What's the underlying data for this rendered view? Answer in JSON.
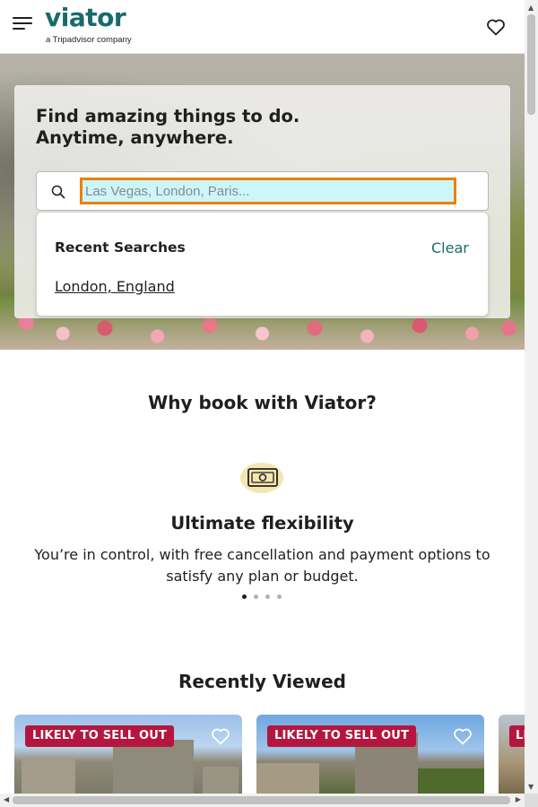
{
  "header": {
    "logo_text": "viator",
    "logo_subtext": "a Tripadvisor company",
    "menu_icon": "hamburger-menu-icon",
    "wishlist_icon": "heart-outline-icon"
  },
  "hero": {
    "title_line1": "Find amazing things to do.",
    "title_line2": "Anytime, anywhere.",
    "search": {
      "placeholder": "Las Vegas, London, Paris...",
      "value": "",
      "icon": "search-icon"
    },
    "recent": {
      "label": "Recent Searches",
      "clear_label": "Clear",
      "items": [
        "London, England"
      ]
    }
  },
  "why_book": {
    "title": "Why book with Viator?",
    "feature": {
      "icon": "money-bill-icon",
      "title": "Ultimate flexibility",
      "description": "You’re in control, with free cancellation and payment options to satisfy any plan or budget."
    },
    "carousel_dots": 4,
    "active_dot": 0
  },
  "recently_viewed": {
    "title": "Recently Viewed",
    "cards": [
      {
        "badge": "LIKELY TO SELL OUT"
      },
      {
        "badge": "LIKELY TO SELL OUT"
      },
      {
        "badge": "LI"
      }
    ]
  },
  "colors": {
    "brand": "#186b6d",
    "badge": "#b5163f",
    "focus_outline": "#ec7f00"
  }
}
